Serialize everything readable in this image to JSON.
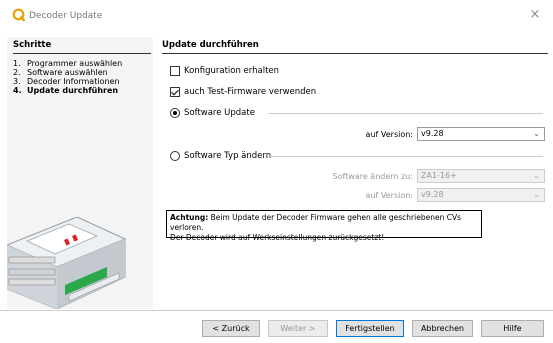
{
  "window": {
    "title": "Decoder Update",
    "close_glyph": "×",
    "accent": "#e8a200"
  },
  "steps": {
    "heading": "Schritte",
    "items": [
      {
        "num": "1.",
        "label": "Programmer auswählen"
      },
      {
        "num": "2.",
        "label": "Software auswählen"
      },
      {
        "num": "3.",
        "label": "Decoder Informationen"
      },
      {
        "num": "4.",
        "label": "Update durchführen"
      }
    ],
    "current_index": 3
  },
  "main": {
    "heading": "Update durchführen",
    "keep_config": {
      "label": "Konfiguration erhalten",
      "checked": false
    },
    "test_firmware": {
      "label": "auch Test-Firmware verwenden",
      "checked": true
    },
    "software_update": {
      "label": "Software Update",
      "selected": true,
      "version_label": "auf Version:",
      "version_value": "v9.28"
    },
    "change_type": {
      "label": "Software Typ ändern",
      "selected": false,
      "change_to_label": "Software ändern zu:",
      "change_to_value": "ZA1-16+",
      "version_label": "auf Version:",
      "version_value": "v9.28"
    },
    "warning": {
      "bold": "Achtung:",
      "line1": "Beim Update der Decoder Firmware gehen alle geschriebenen CVs verloren.",
      "line2": "Der Decoder wird auf Werkseinstellungen zurückgesetzt!"
    }
  },
  "buttons": {
    "back": "< Zurück",
    "next": "Weiter >",
    "finish": "Fertigstellen",
    "cancel": "Abbrechen",
    "help": "Hilfe"
  },
  "icons": {
    "app": "q-logo-icon",
    "close": "close-icon",
    "chevron": "chevron-down-icon"
  }
}
